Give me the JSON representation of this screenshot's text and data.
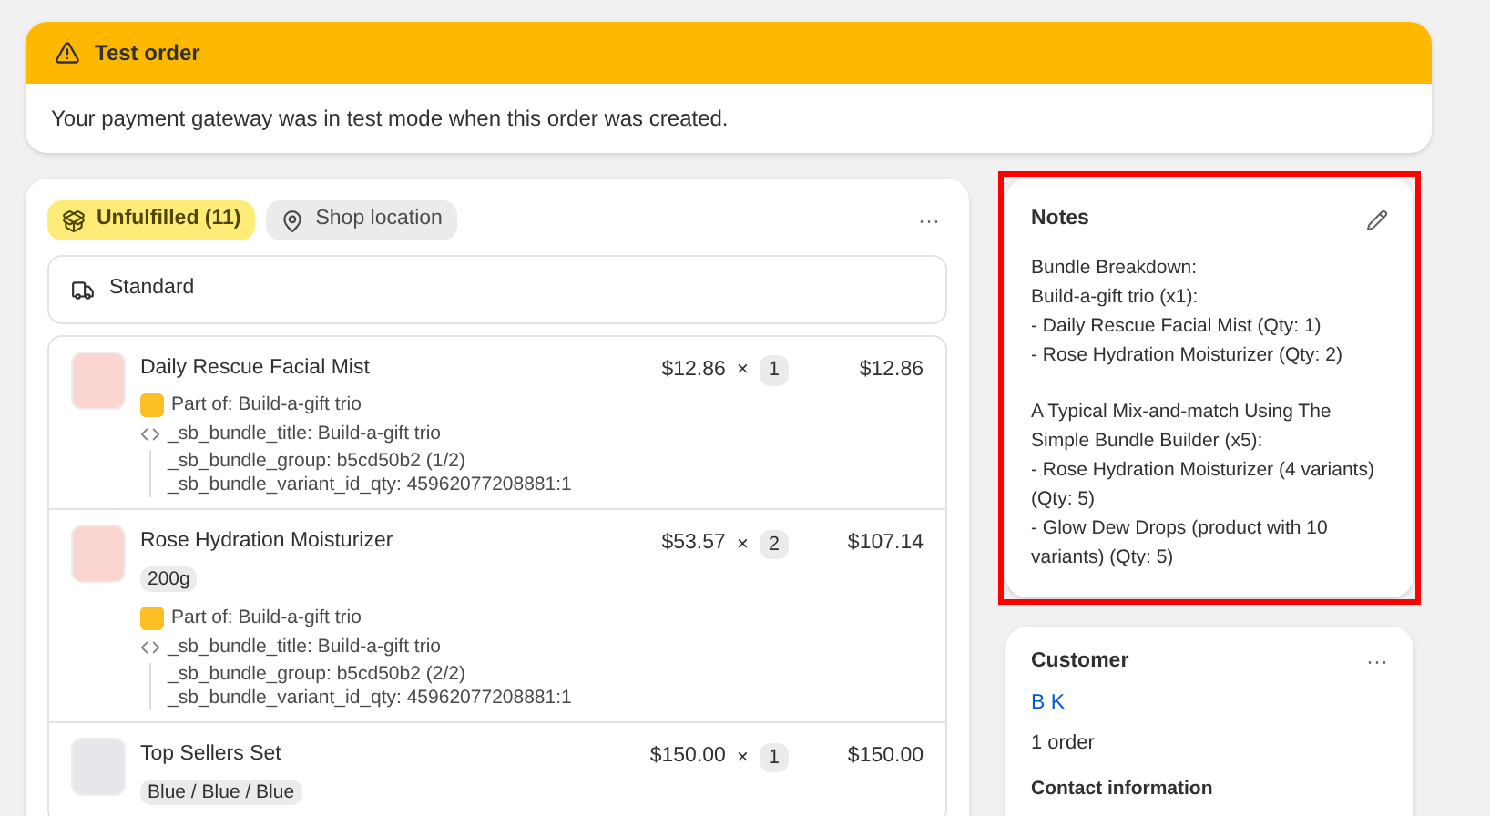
{
  "banner": {
    "title": "Test order",
    "message": "Your payment gateway was in test mode when this order was created."
  },
  "fulfillment": {
    "status": "Unfulfilled (11)",
    "location": "Shop location",
    "more": "···",
    "shipping": "Standard",
    "items": [
      {
        "name": "Daily Rescue Facial Mist",
        "price": "$12.86",
        "times": "×",
        "qty": "1",
        "total": "$12.86",
        "color": "#fbd5d0",
        "part_of": "Part of: Build-a-gift trio",
        "props": [
          "_sb_bundle_title: Build-a-gift trio",
          "_sb_bundle_group: b5cd50b2 (1/2)",
          "_sb_bundle_variant_id_qty: 45962077208881:1"
        ]
      },
      {
        "name": "Rose Hydration Moisturizer",
        "variant": "200g",
        "price": "$53.57",
        "times": "×",
        "qty": "2",
        "total": "$107.14",
        "color": "#fbd5d0",
        "part_of": "Part of: Build-a-gift trio",
        "props": [
          "_sb_bundle_title: Build-a-gift trio",
          "_sb_bundle_group: b5cd50b2 (2/2)",
          "_sb_bundle_variant_id_qty: 45962077208881:1"
        ]
      },
      {
        "name": "Top Sellers Set",
        "variant": "Blue / Blue / Blue",
        "price": "$150.00",
        "times": "×",
        "qty": "1",
        "total": "$150.00",
        "color": "#e5e7eb"
      }
    ]
  },
  "notes": {
    "title": "Notes",
    "highlighted": true,
    "paragraphs": [
      [
        "Bundle Breakdown:",
        "Build-a-gift trio (x1):",
        "- Daily Rescue Facial Mist (Qty: 1)",
        "- Rose Hydration Moisturizer (Qty: 2)"
      ],
      [
        "A Typical Mix-and-match Using The Simple Bundle Builder (x5):",
        "- Rose Hydration Moisturizer (4 variants) (Qty: 5)",
        "- Glow Dew Drops (product with 10 variants) (Qty: 5)"
      ]
    ]
  },
  "customer": {
    "title": "Customer",
    "more": "···",
    "name": "B K",
    "orders": "1 order",
    "contact_title": "Contact information"
  }
}
